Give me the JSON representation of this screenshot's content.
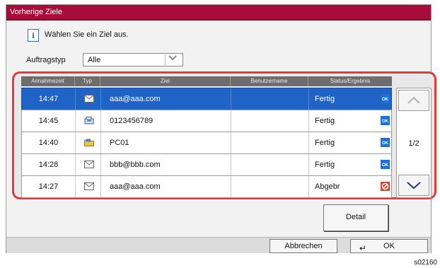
{
  "window": {
    "title": "Vorherige Ziele"
  },
  "info": {
    "icon": "info-icon",
    "icon_glyph": "i",
    "text": "Wählen Sie ein Ziel aus."
  },
  "filter": {
    "label": "Auftragstyp",
    "value": "Alle"
  },
  "table": {
    "headers": [
      "Annahmezeit",
      "Typ",
      "Ziel",
      "Benutzername",
      "Status/Ergebnis"
    ],
    "rows": [
      {
        "time": "14:47",
        "type": "email-icon",
        "destination": "aaa@aaa.com",
        "user": "",
        "status": "Fertig",
        "status_icon": "ok-icon",
        "selected": true
      },
      {
        "time": "14:45",
        "type": "fax-icon",
        "destination": "0123456789",
        "user": "",
        "status": "Fertig",
        "status_icon": "ok-icon",
        "selected": false
      },
      {
        "time": "14:40",
        "type": "folder-icon",
        "destination": "PC01",
        "user": "",
        "status": "Fertig",
        "status_icon": "ok-icon",
        "selected": false
      },
      {
        "time": "14:28",
        "type": "email-icon",
        "destination": "bbb@bbb.com",
        "user": "",
        "status": "Fertig",
        "status_icon": "ok-icon",
        "selected": false
      },
      {
        "time": "14:27",
        "type": "email-icon",
        "destination": "aaa@aaa.com",
        "user": "",
        "status": "Abgebr",
        "status_icon": "cancelled-icon",
        "selected": false
      }
    ],
    "ok_badge": "OK",
    "page": "1/2"
  },
  "buttons": {
    "detail": "Detail",
    "cancel": "Abbrechen",
    "ok": "OK"
  },
  "figure_code": "s02160",
  "colors": {
    "title_bar": "#a70d3b",
    "selected_row": "#1f63c6",
    "highlight_frame": "#e33b3b",
    "ok_badge": "#1f6fd1",
    "cancelled_badge": "#d9442b"
  }
}
